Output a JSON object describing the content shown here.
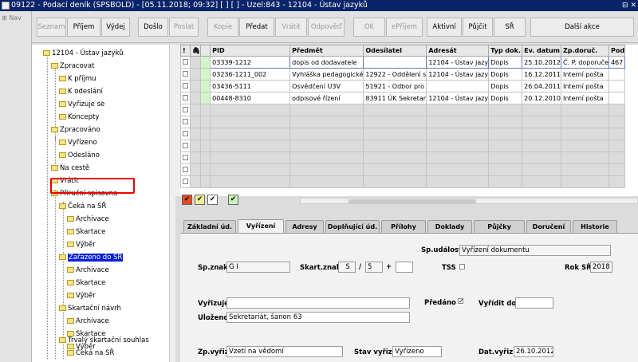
{
  "window": {
    "title": "09122 - Podací deník (SPSBOLD) - [05.11.2018; 09:32]  [ ]  [ ] - Uzel:843 - 12104 - Ústav jazyků",
    "controls": "⊟ ✕"
  },
  "nav": {
    "label": "Nav"
  },
  "toolbar": {
    "seznam": "Seznam",
    "prijem": "Příjem",
    "vydej": "Výdej",
    "doslo": "Došlo",
    "poslat": "Poslat",
    "kopie": "Kopie",
    "predat": "Předat",
    "vratit": "Vrátit",
    "odpoved": "Odpověď",
    "ok": "OK",
    "eprijem": "ePříjem",
    "aktivni": "Aktivní",
    "pujcit": "Půjčit",
    "sr": "SŘ",
    "dalsi_akce": "Další akce"
  },
  "tree": {
    "root": "12104 - Ústav jazyků",
    "zpracovat": "Zpracovat",
    "k_prijmu": "K příjmu",
    "k_odeslani": "K odeslání",
    "vyrizuje_se": "Vyřizuje se",
    "koncepty": "Koncepty",
    "zpracovano": "Zpracováno",
    "vyrizeno": "Vyřízeno",
    "odeslano": "Odesláno",
    "na_ceste": "Na cestě",
    "vratit": "Vrátit",
    "prirucni_spisovna": "Příruční spisovna",
    "ceka_na_sr": "Čeká na SŘ",
    "archivace1": "Archivace",
    "skartace1": "Skartace",
    "vyber1": "Výběr",
    "zarazeno_do_sr": "Zařazeno do SŘ",
    "archivace2": "Archivace",
    "skartace2": "Skartace",
    "vyber2": "Výběr",
    "skartacni_navrh": "Skartační návrh",
    "archivace3": "Archivace",
    "skartace3": "Skartace",
    "vyber3": "Výběr",
    "trvaly_souhlas": "Trvalý skartační souhlas",
    "ceka_na_sr2": "Čeká na SŘ"
  },
  "grid": {
    "headers": {
      "excl": "!",
      "clip": "🖇",
      "pid": "PID",
      "predmet": "Předmět",
      "odesilatel": "Odesílatel",
      "adresat": "Adresát",
      "typ": "Typ dok.",
      "ev_datum": "Ev. datum",
      "zp_doruc": "Zp.doruč.",
      "pod": "Pod"
    },
    "rows": [
      {
        "pid": "03339-1212",
        "predmet": "dopis od dodavatele",
        "odesilatel": "",
        "adresat": "12104 - Ústav jazy",
        "typ": "Dopis",
        "ev_datum": "25.10.2012",
        "zp_doruc": "Č. P. doporuče",
        "pod": "467"
      },
      {
        "pid": "03236-1211_002",
        "predmet": "Vyhláška pedagogické",
        "odesilatel": "12922 - Oddělení s",
        "adresat": "12104 - Ústav jazy",
        "typ": "Dopis",
        "ev_datum": "16.12.2011",
        "zp_doruc": "Interní pošta",
        "pod": ""
      },
      {
        "pid": "03436-5111",
        "predmet": "Osvědčení U3V",
        "odesilatel": "51921 - Odbor pro",
        "adresat": "",
        "typ": "Dopis",
        "ev_datum": "26.04.2011",
        "zp_doruc": "Interní pošta",
        "pod": ""
      },
      {
        "pid": "00448-8310",
        "predmet": "odpisové řízení",
        "odesilatel": "83911 ÚK Sekretar",
        "adresat": "12104 - Ústav jazy",
        "typ": "Dopis",
        "ev_datum": "20.12.2010",
        "zp_doruc": "Interní pošta",
        "pod": ""
      }
    ]
  },
  "flags": {
    "f1": "✔",
    "f2": "✔",
    "f3": "✔",
    "f4": "✔"
  },
  "tabs": [
    "Základní úd.",
    "Vyřízení",
    "Adresy",
    "Doplňující úd.",
    "Přílohy",
    "Doklady",
    "Půjčky",
    "Doručení",
    "Historie"
  ],
  "form": {
    "sp_udalost_label": "Sp.událost",
    "sp_udalost": "Vyřízení dokumentu",
    "sp_znak_label": "Sp.znak",
    "sp_znak": "G I",
    "skart_znak_label": "Skart.znak",
    "skart_znak": "S",
    "slash": "/",
    "skart_lhuta": "5",
    "plus": "+",
    "skart_extra": "",
    "tss_label": "TSS",
    "rok_sr_label": "Rok SŘ",
    "rok_sr": "2018",
    "vyrizuje_label": "Vyřizuje",
    "vyrizuje": "",
    "predano_label": "Předáno",
    "predano_check": "✓",
    "vyridit_do_label": "Vyřídit do",
    "vyridit_do": "",
    "ulozeno_label": "Uloženo",
    "ulozeno": "Sekretariát, šanon 63",
    "zp_vyriz_label": "Zp.vyřiz.",
    "zp_vyriz": "Vzetí na vědomí",
    "stav_vyriz_label": "Stav vyřiz.",
    "stav_vyriz": "Vyřízeno",
    "dat_vyriz_label": "Dat.vyřiz.",
    "dat_vyriz": "26.10.2012"
  },
  "colors": {
    "titlebar": "#0a246a",
    "selection": "#0a1fd6",
    "highlight": "#e00000",
    "green_cell": "#d3f5c9"
  }
}
